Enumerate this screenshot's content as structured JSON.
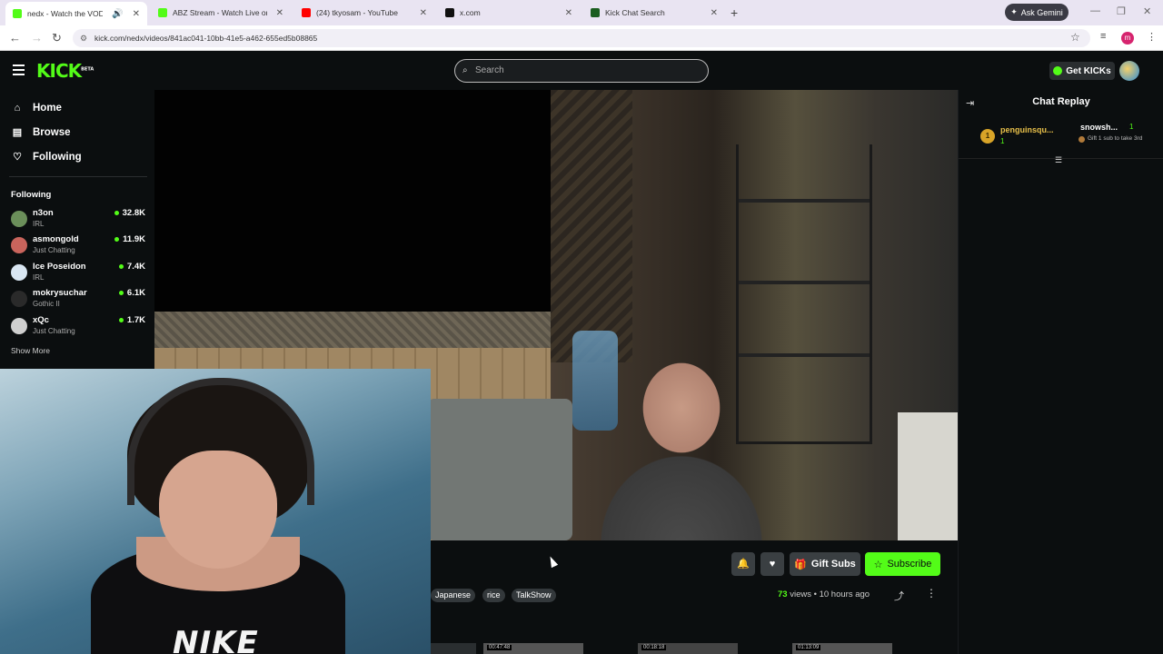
{
  "browser": {
    "tabs": [
      {
        "title": "nedx - Watch the VOD on Kick",
        "color": "#53fc18",
        "active": true
      },
      {
        "title": "ABZ Stream - Watch Live on Kick",
        "color": "#53fc18",
        "active": false
      },
      {
        "title": "(24) tkyosam - YouTube",
        "color": "#ff0000",
        "active": false
      },
      {
        "title": "x.com",
        "color": "#111111",
        "active": false
      },
      {
        "title": "Kick Chat Search",
        "color": "#1b5e20",
        "active": false
      }
    ],
    "gemini_label": "Ask Gemini",
    "url": "kick.com/nedx/videos/841ac041-10bb-41e5-a462-655ed5b08865",
    "profile_initial": "m"
  },
  "header": {
    "logo": "KICK",
    "logo_badge": "BETA",
    "search_placeholder": "Search",
    "get_kicks_label": "Get KICKs"
  },
  "sidebar": {
    "nav": [
      {
        "label": "Home",
        "icon": "home-icon"
      },
      {
        "label": "Browse",
        "icon": "browse-icon"
      },
      {
        "label": "Following",
        "icon": "heart-icon"
      }
    ],
    "following_heading": "Following",
    "following": [
      {
        "name": "n3on",
        "category": "IRL",
        "viewers": "32.8K",
        "avatar_color": "#6b8f5a"
      },
      {
        "name": "asmongold",
        "category": "Just Chatting",
        "viewers": "11.9K",
        "avatar_color": "#c9645c"
      },
      {
        "name": "Ice Poseidon",
        "category": "IRL",
        "viewers": "7.4K",
        "avatar_color": "#d9e6f2"
      },
      {
        "name": "mokrysuchar",
        "category": "Gothic II",
        "viewers": "6.1K",
        "avatar_color": "#2a2a2a"
      },
      {
        "name": "xQc",
        "category": "Just Chatting",
        "viewers": "1.7K",
        "avatar_color": "#cfcfcf"
      }
    ],
    "show_more": "Show More"
  },
  "video_actions": {
    "gift_label": "Gift Subs",
    "subscribe_label": "Subscribe",
    "tags": [
      "Japanese",
      "rice",
      "TalkShow"
    ],
    "views_count": "73",
    "views_word": "views",
    "time_ago": "10 hours ago",
    "thumb_times": [
      "",
      "00:47:48",
      "00:18:18",
      "01:13:09"
    ]
  },
  "chat": {
    "title": "Chat Replay",
    "top_gifter": {
      "rank": "1",
      "name": "penguinsqu...",
      "count": "1"
    },
    "second_gifter": {
      "name": "snowsh...",
      "count": "1",
      "note": "Gift 1 sub to take 3rd"
    }
  },
  "colors": {
    "accent": "#53fc18",
    "background": "#0b0e0f"
  }
}
